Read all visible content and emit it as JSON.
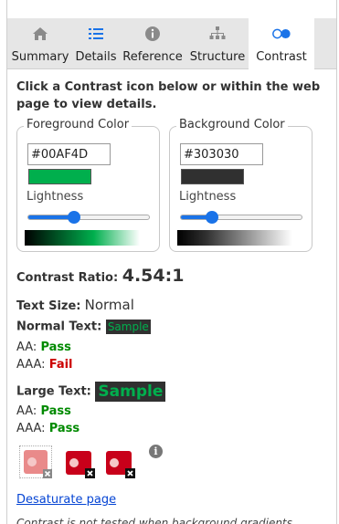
{
  "tabs": [
    {
      "label": "Summary",
      "icon": "home-icon",
      "active": false
    },
    {
      "label": "Details",
      "icon": "list-icon",
      "active": false
    },
    {
      "label": "Reference",
      "icon": "info-icon",
      "active": false
    },
    {
      "label": "Structure",
      "icon": "hierarchy-icon",
      "active": false
    },
    {
      "label": "Contrast",
      "icon": "contrast-icon",
      "active": true
    }
  ],
  "intro": "Click a Contrast icon below or within the web page to view details.",
  "foreground": {
    "legend": "Foreground Color",
    "value": "#00AF4D",
    "lightness_label": "Lightness",
    "lightness": 0.38,
    "swatch_color": "#00AF4D"
  },
  "background": {
    "legend": "Background Color",
    "value": "#303030",
    "lightness_label": "Lightness",
    "lightness": 0.26,
    "swatch_color": "#303030"
  },
  "contrast": {
    "label": "Contrast Ratio:",
    "value": "4.54:1"
  },
  "text_size": {
    "label": "Text Size:",
    "value": "Normal"
  },
  "normal_text": {
    "label": "Normal Text:",
    "sample": "Sample",
    "aa_label": "AA:",
    "aa_value": "Pass",
    "aaa_label": "AAA:",
    "aaa_value": "Fail"
  },
  "large_text": {
    "label": "Large Text:",
    "sample": "Sample",
    "aa_label": "AA:",
    "aa_value": "Pass",
    "aaa_label": "AAA:",
    "aaa_value": "Pass"
  },
  "desaturate_link": "Desaturate page",
  "note": "Contrast is not tested when background gradients",
  "colors": {
    "accent": "#1a73e8",
    "pass": "#008a00",
    "fail": "#cc0000",
    "link": "#0645d4",
    "tab_bar": "#e6e6e6"
  }
}
